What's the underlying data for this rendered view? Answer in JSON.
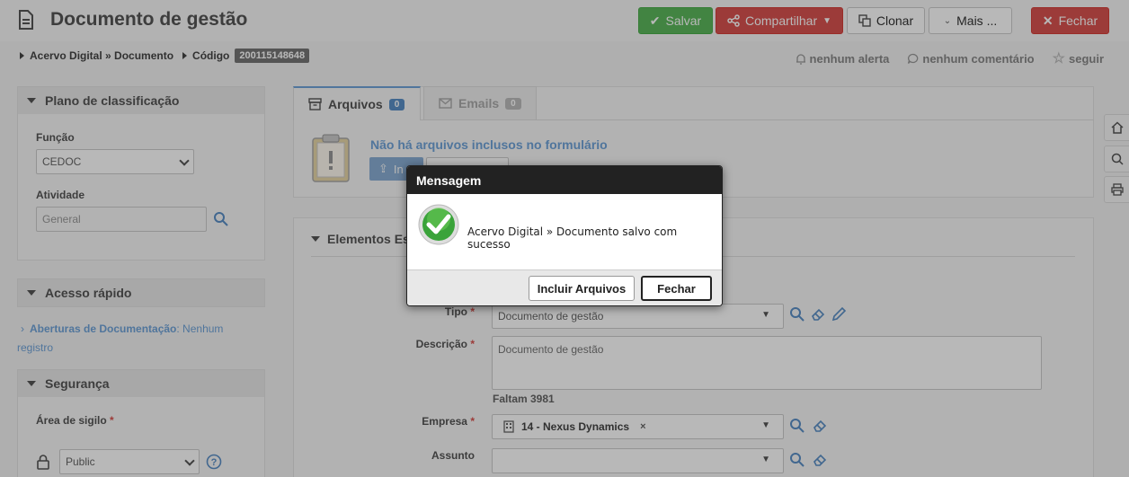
{
  "header": {
    "title": "Documento de gestão",
    "buttons": {
      "save": "Salvar",
      "share": "Compartilhar",
      "clone": "Clonar",
      "more": "Mais ...",
      "close": "Fechar"
    }
  },
  "breadcrumb": {
    "path": "Acervo Digital » Documento",
    "code_label": "Código",
    "code_value": "200115148648"
  },
  "meta": {
    "alerts": "nenhum alerta",
    "comments": "nenhum comentário",
    "follow": "seguir"
  },
  "sidebar": {
    "classification": {
      "title": "Plano de classificação",
      "function_label": "Função",
      "function_value": "CEDOC",
      "activity_label": "Atividade",
      "activity_value": "General"
    },
    "quick_access": {
      "title": "Acesso rápido",
      "link": "Aberturas de Documentação",
      "link_suffix": ": Nenhum registro"
    },
    "security": {
      "title": "Segurança",
      "secrecy_label": "Área de sigilo",
      "secrecy_value": "Public"
    }
  },
  "main": {
    "tabs": [
      {
        "label": "Arquivos",
        "count": "0"
      },
      {
        "label": "Emails",
        "count": "0"
      }
    ],
    "empty_message": "Não há arquivos inclusos no formulário",
    "include_button": "In",
    "elements_title": "Elementos Es",
    "form": {
      "type_label": "Tipo",
      "type_value": "Documento de gestão",
      "description_label": "Descrição",
      "description_value": "Documento de gestão",
      "remaining": "Faltam 3981",
      "company_label": "Empresa",
      "company_value": "14 - Nexus Dynamics",
      "subject_label": "Assunto"
    }
  },
  "dialog": {
    "title": "Mensagem",
    "message": "Acervo Digital » Documento salvo com sucesso",
    "include_button": "Incluir Arquivos",
    "close_button": "Fechar"
  },
  "colors": {
    "save": "#5cb85c",
    "danger": "#d9534f",
    "accent": "#5b8fc7",
    "success_icon": "#3aa33a"
  }
}
